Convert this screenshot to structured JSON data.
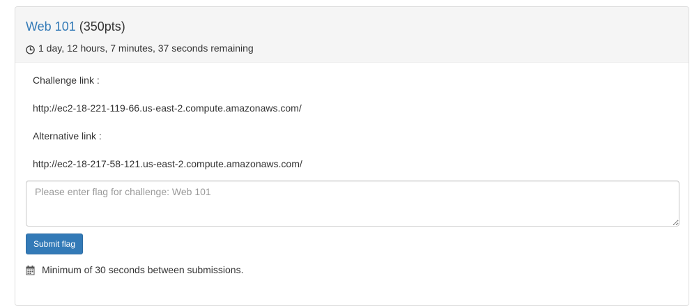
{
  "challenge": {
    "name": "Web 101",
    "points": "(350pts)",
    "time_remaining": "1 day, 12 hours, 7 minutes, 37 seconds remaining"
  },
  "description": {
    "challenge_link_label": "Challenge link :",
    "challenge_link_url": "http://ec2-18-221-119-66.us-east-2.compute.amazonaws.com/",
    "alternative_link_label": "Alternative link :",
    "alternative_link_url": "http://ec2-18-217-58-121.us-east-2.compute.amazonaws.com/"
  },
  "form": {
    "flag_placeholder": "Please enter flag for challenge: Web 101",
    "flag_value": "",
    "submit_label": "Submit flag",
    "rate_limit_note": "Minimum of 30 seconds between submissions."
  },
  "icons": {
    "time": "clock-icon",
    "note": "calendar-icon"
  },
  "colors": {
    "accent": "#337ab7",
    "heading_bg": "#f5f5f5"
  }
}
